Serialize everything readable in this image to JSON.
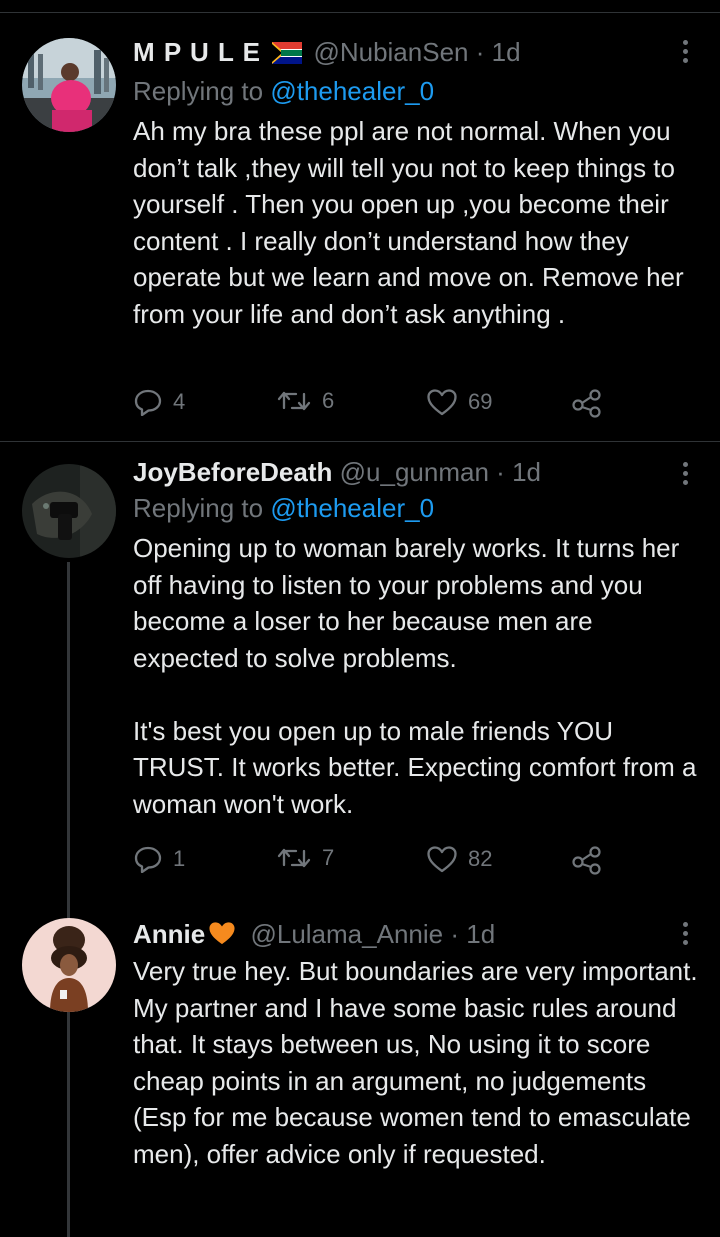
{
  "tweets": [
    {
      "name": "M P U L E",
      "flag": "🇿🇦",
      "handle": "@NubianSen",
      "dot": "·",
      "time": "1d",
      "reply_prefix": "Replying to",
      "reply_to": "@thehealer_0",
      "text": "Ah my bra these ppl are not normal. When you don’t talk ,they will tell you not to keep things to yourself . Then you open up ,you become their content . I really don’t understand how they operate but we learn and move on. Remove her from your life and don’t ask anything .",
      "replies": "4",
      "retweets": "6",
      "likes": "69"
    },
    {
      "name": "JoyBeforeDeath",
      "handle": "@u_gunman",
      "dot": "·",
      "time": "1d",
      "reply_prefix": "Replying to",
      "reply_to": "@thehealer_0",
      "text": "Opening up to woman barely works. It turns her off having to listen to your problems and you become a loser to her because men are expected to solve problems.\n\nIt's best you open up to male friends YOU TRUST. It works better. Expecting comfort from a woman won't work.",
      "replies": "1",
      "retweets": "7",
      "likes": "82"
    },
    {
      "name": "Annie",
      "heart": "🧡",
      "handle": "@Lulama_Annie",
      "dot": "·",
      "time": "1d",
      "text": "Very true hey. But boundaries are very important. My partner and I have some basic rules around that. It stays between us, No using it to score cheap points in an argument, no judgements (Esp for me because women tend to emasculate men), offer advice only if requested."
    }
  ],
  "colors": {
    "background": "#000000",
    "text": "#e7e9ea",
    "secondary": "#71767b",
    "link": "#1d9bf0",
    "divider": "#2f3336"
  },
  "icons": [
    "reply-icon",
    "retweet-icon",
    "like-icon",
    "share-icon",
    "more-icon"
  ]
}
